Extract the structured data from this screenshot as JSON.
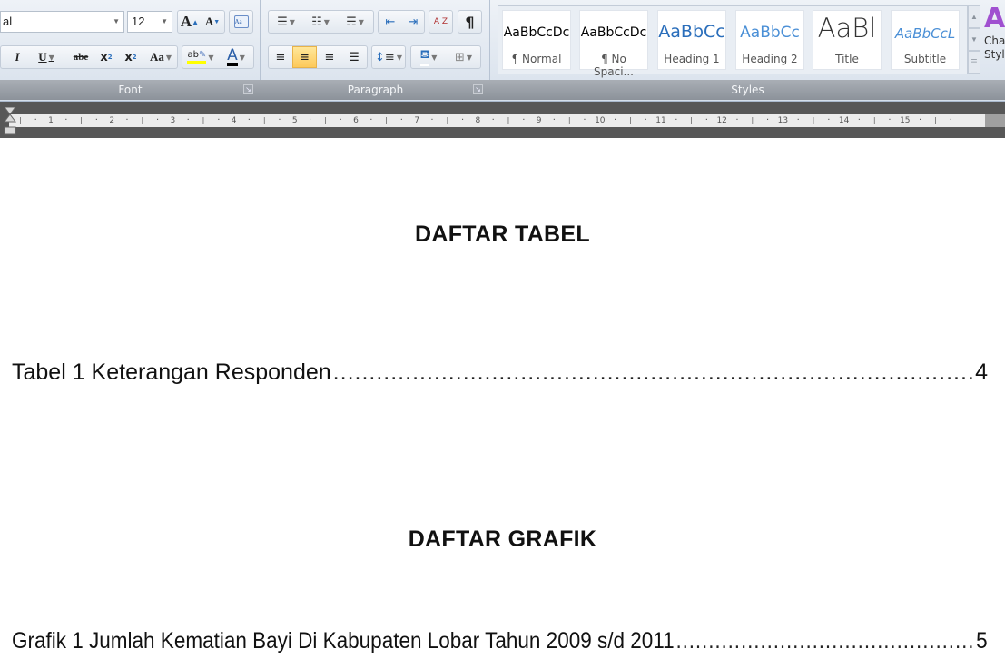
{
  "ribbon": {
    "font": {
      "label": "Font",
      "font_name": "al",
      "font_size": "12",
      "grow_font": "A",
      "shrink_font": "A",
      "italic": "I",
      "underline": "U",
      "strikethrough": "abe",
      "subscript": "x",
      "superscript": "x",
      "change_case": "Aa",
      "highlight": "ab",
      "font_color": "A",
      "highlight_color": "#ffff00",
      "font_color_value": "#000000"
    },
    "paragraph": {
      "label": "Paragraph",
      "sort": "A Z",
      "show_marks": "¶"
    },
    "styles": {
      "label": "Styles",
      "items": [
        {
          "sample": "AaBbCcDc",
          "name": "¶ Normal",
          "color": "#000000"
        },
        {
          "sample": "AaBbCcDc",
          "name": "¶ No Spaci...",
          "color": "#000000"
        },
        {
          "sample": "AaBbCc",
          "name": "Heading 1",
          "color": "#2a6ebb"
        },
        {
          "sample": "AaBbCc",
          "name": "Heading 2",
          "color": "#4a8fd6"
        },
        {
          "sample": "AaBl",
          "name": "Title",
          "color": "#333333"
        },
        {
          "sample": "AaBbCcL",
          "name": "Subtitle",
          "color": "#4a8fd6"
        }
      ],
      "change_styles": "Cha Styl"
    }
  },
  "ruler": {
    "ticks": [
      "1",
      "2",
      "3",
      "4",
      "5",
      "6",
      "7",
      "8",
      "9",
      "10",
      "11",
      "12",
      "13",
      "14",
      "15"
    ]
  },
  "document": {
    "heading_tables": "DAFTAR TABEL",
    "table_entries": [
      {
        "text": "Tabel 1 Keterangan Responden",
        "page": "4"
      }
    ],
    "heading_charts": "DAFTAR GRAFIK",
    "chart_entries": [
      {
        "text": "Grafik 1 Jumlah Kematian Bayi Di Kabupaten Lobar Tahun 2009 s/d 2011",
        "page": "5"
      }
    ]
  }
}
